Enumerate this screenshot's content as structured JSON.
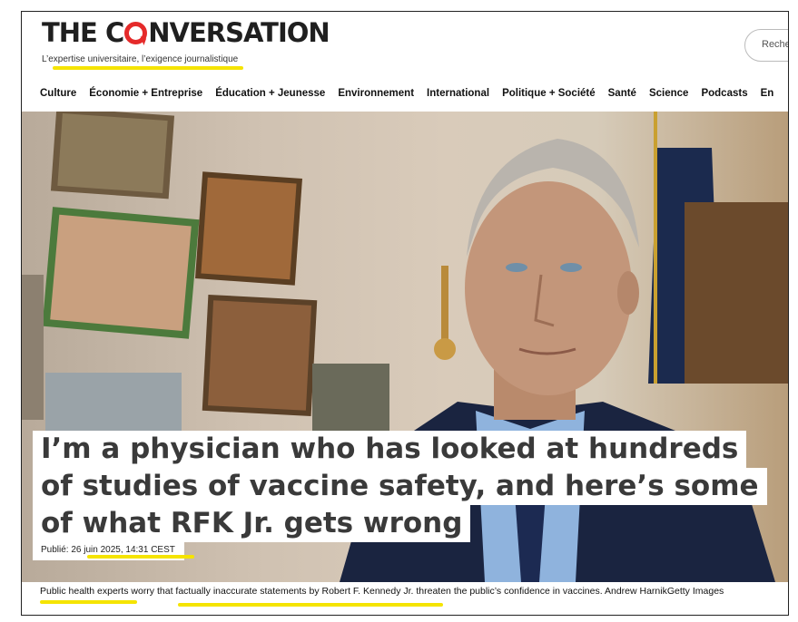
{
  "header": {
    "logo_text_1": "THE C",
    "logo_text_2": "NVERSATION",
    "tagline": "L’expertise universitaire, l’exigence journalistique",
    "search_placeholder": "Reche"
  },
  "nav": {
    "items": [
      "Culture",
      "Économie + Entreprise",
      "Éducation + Jeunesse",
      "Environnement",
      "International",
      "Politique + Société",
      "Santé",
      "Science",
      "Podcasts",
      "En"
    ]
  },
  "article": {
    "headline_lines": [
      "I’m a physician who has looked at hundreds",
      "of studies of vaccine safety, and here’s some",
      "of what RFK Jr. gets wrong"
    ],
    "published_label": "Publié:",
    "published_date": "26 juin 2025, 14:31 CEST",
    "caption": "Public health experts worry that factually inaccurate statements by Robert F. Kennedy Jr. threaten the public’s confidence in vaccines. Andrew HarnikGetty Images"
  },
  "colors": {
    "accent_red": "#e52a2a",
    "highlight_yellow": "#f5e400"
  }
}
